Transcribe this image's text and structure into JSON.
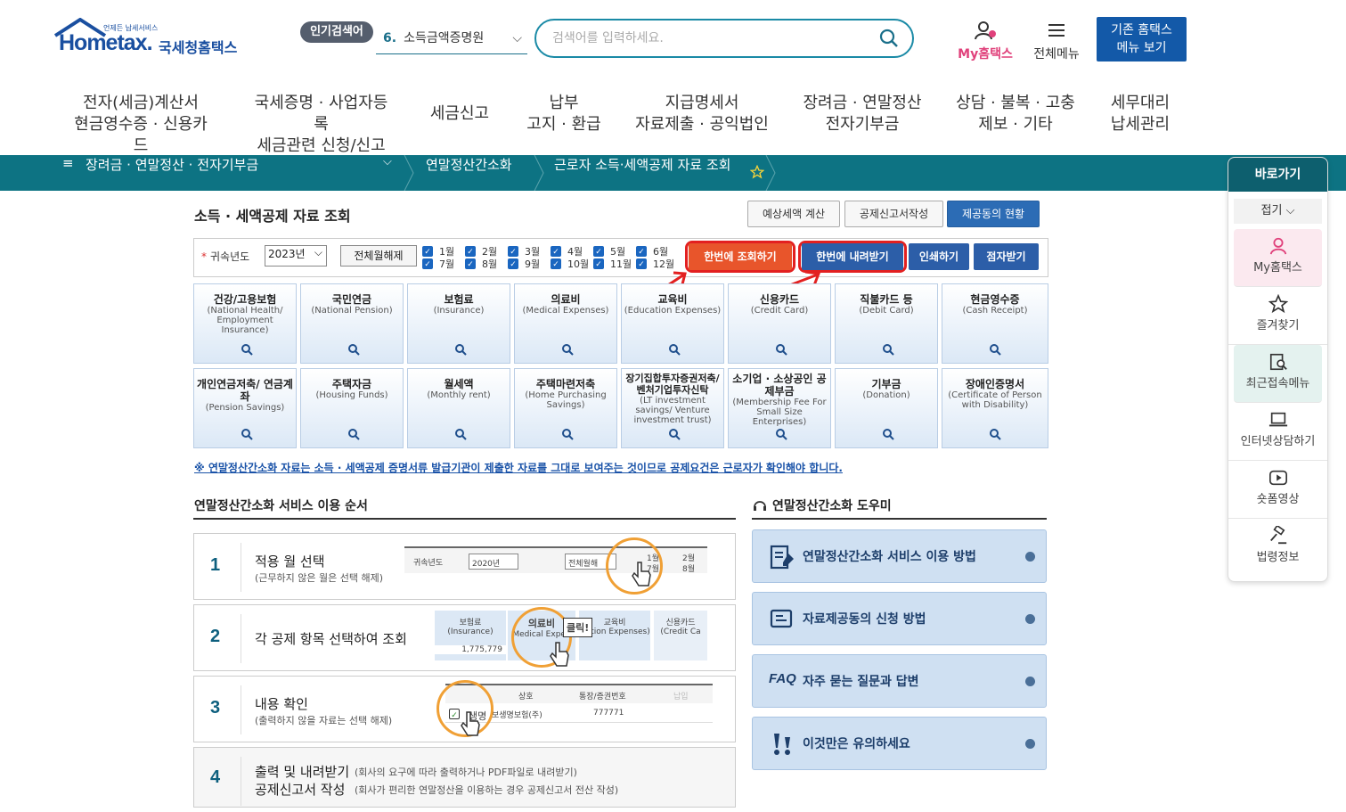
{
  "header": {
    "logo_main": "Hometax.",
    "logo_sub": "국세청홈택스",
    "logo_tiny": "언제든 납세서비스",
    "popular_badge": "인기검색어",
    "popular_rank": "6.",
    "popular_term": "소득금액증명원",
    "search_placeholder": "검색어를 입력하세요.",
    "my_label": "My홈택스",
    "menu_label": "전체메뉴",
    "legacy_line1": "기존 홈택스",
    "legacy_line2": "메뉴 보기"
  },
  "gnb": [
    {
      "l1": "전자(세금)계산서",
      "l2": "현금영수증 · 신용카드"
    },
    {
      "l1": "국세증명 · 사업자등록",
      "l2": "세금관련 신청/신고"
    },
    {
      "l1": "세금신고",
      "l2": ""
    },
    {
      "l1": "납부",
      "l2": "고지 · 환급"
    },
    {
      "l1": "지급명세서",
      "l2": "자료제출 · 공익법인"
    },
    {
      "l1": "장려금 · 연말정산",
      "l2": "전자기부금"
    },
    {
      "l1": "상담 · 불복 · 고충",
      "l2": "제보 · 기타"
    },
    {
      "l1": "세무대리",
      "l2": "납세관리"
    }
  ],
  "breadcrumb": {
    "menu_icon": "≡",
    "level1": "장려금 · 연말정산 · 전자기부금",
    "level2": "연말정산간소화",
    "level3": "근로자 소득·세액공제 자료 조회"
  },
  "quick": {
    "title": "바로가기",
    "fold": "접기",
    "items": [
      "My홈택스",
      "즐겨찾기",
      "최근접속메뉴",
      "인터넷상담하기",
      "숏폼영상",
      "법령정보"
    ]
  },
  "page": {
    "title": "소득 · 세액공제 자료 조회",
    "top_buttons": [
      "예상세액 계산",
      "공제신고서작성",
      "제공동의 현황"
    ],
    "year_label": "귀속년도",
    "year_value": "2023년",
    "clear_all": "전체월해제",
    "months_row1": [
      "1월",
      "2월",
      "3월",
      "4월",
      "5월",
      "6월"
    ],
    "months_row2": [
      "7월",
      "8월",
      "9월",
      "10월",
      "11월",
      "12월"
    ],
    "action_buttons": [
      "한번에 조회하기",
      "한번에 내려받기",
      "인쇄하기",
      "점자받기"
    ],
    "categories_row1": [
      {
        "k": "건강/고용보험",
        "e": "(National Health/ Employment Insurance)"
      },
      {
        "k": "국민연금",
        "e": "(National Pension)"
      },
      {
        "k": "보험료",
        "e": "(Insurance)"
      },
      {
        "k": "의료비",
        "e": "(Medical Expenses)"
      },
      {
        "k": "교육비",
        "e": "(Education Expenses)"
      },
      {
        "k": "신용카드",
        "e": "(Credit Card)"
      },
      {
        "k": "직불카드 등",
        "e": "(Debit Card)"
      },
      {
        "k": "현금영수증",
        "e": "(Cash Receipt)"
      }
    ],
    "categories_row2": [
      {
        "k": "개인연금저축/ 연금계좌",
        "e": "(Pension Savings)"
      },
      {
        "k": "주택자금",
        "e": "(Housing Funds)"
      },
      {
        "k": "월세액",
        "e": "(Monthly rent)"
      },
      {
        "k": "주택마련저축",
        "e": "(Home Purchasing Savings)"
      },
      {
        "k": "장기집합투자증권저축/ 벤처기업투자신탁",
        "e": "(LT investment savings/ Venture investment trust)"
      },
      {
        "k": "소기업 · 소상공인 공제부금",
        "e": "(Membership Fee For Small Size Enterprises)"
      },
      {
        "k": "기부금",
        "e": "(Donation)"
      },
      {
        "k": "장애인증명서",
        "e": "(Certificate of Person with Disability)"
      }
    ],
    "notice": "※ 연말정산간소화 자료는 소득 · 세액공제 증명서류 발급기관이 제출한 자료를 그대로 보여주는 것이므로 공제요건은 근로자가 확인해야 합니다."
  },
  "steps_section": {
    "title": "연말정산간소화 서비스 이용 순서",
    "steps": [
      {
        "num": "1",
        "title": "적용 월 선택",
        "sub": "(근무하지 않은 월은 선택 해제)"
      },
      {
        "num": "2",
        "title": "각 공제 항목 선택하여 조회",
        "sub": ""
      },
      {
        "num": "3",
        "title": "내용 확인",
        "sub": "(출력하지 않을 자료는 선택 해제)"
      },
      {
        "num": "4",
        "title": "출력 및 내려받기",
        "sub": "(회사의 요구에 따라 출력하거나 PDF파일로 내려받기)",
        "title2": "공제신고서 작성",
        "sub2": "(회사가 편리한 연말정산을 이용하는 경우 공제신고서 전산 작성)"
      }
    ],
    "illus1": {
      "year_label": "귀속년도",
      "year": "2020년",
      "clear": "전체월해",
      "m1": "1월",
      "m7": "7월",
      "m2": "2월",
      "m8": "8월"
    },
    "illus2": {
      "c1": "보험료",
      "c1e": "(Insurance)",
      "c2": "의료비",
      "c2e": "Medical Expen",
      "c3": "교육비",
      "c3e": "ication Expenses)",
      "c4": "신용카드",
      "c4e": "(Credit Ca",
      "amount": "1,775,779",
      "click": "클릭!"
    },
    "illus3": {
      "h1": "상호",
      "h2": "통장/증권번호",
      "h3": "납입",
      "r1": "생명",
      "r1b": "보생명보험(주)",
      "r1n": "777771"
    }
  },
  "helper_section": {
    "title": "연말정산간소화 도우미",
    "items": [
      "연말정산간소화 서비스 이용 방법",
      "자료제공동의 신청 방법",
      "자주 묻는 질문과 답변",
      "이것만은 유의하세요"
    ],
    "faq_prefix": "FAQ"
  }
}
